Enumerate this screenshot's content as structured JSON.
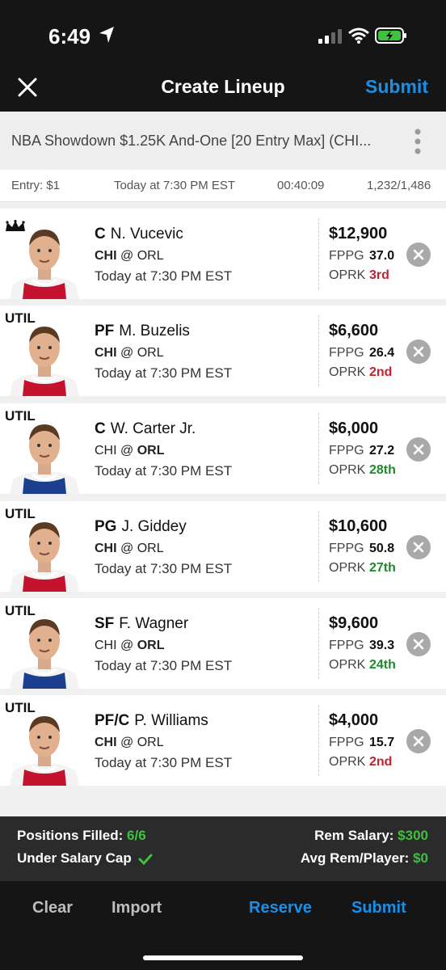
{
  "status_bar": {
    "time": "6:49"
  },
  "header": {
    "title": "Create Lineup",
    "submit_label": "Submit"
  },
  "contest": {
    "name": "NBA Showdown $1.25K And-One [20 Entry Max] (CHI...",
    "entry": "Entry: $1",
    "start": "Today at 7:30 PM EST",
    "countdown": "00:40:09",
    "entries": "1,232/1,486"
  },
  "players": [
    {
      "slot": "",
      "crown": true,
      "pos": "C",
      "name": "N. Vucevic",
      "team": "CHI",
      "at": "@",
      "opp": "ORL",
      "bold_side": "team",
      "time": "Today at 7:30 PM EST",
      "salary": "$12,900",
      "fppg_label": "FPPG",
      "fppg": "37.0",
      "oprk_label": "OPRK",
      "oprk": "3rd",
      "oprk_color": "red",
      "jersey": "red"
    },
    {
      "slot": "UTIL",
      "crown": false,
      "pos": "PF",
      "name": "M. Buzelis",
      "team": "CHI",
      "at": "@",
      "opp": "ORL",
      "bold_side": "team",
      "time": "Today at 7:30 PM EST",
      "salary": "$6,600",
      "fppg_label": "FPPG",
      "fppg": "26.4",
      "oprk_label": "OPRK",
      "oprk": "2nd",
      "oprk_color": "red",
      "jersey": "red"
    },
    {
      "slot": "UTIL",
      "crown": false,
      "pos": "C",
      "name": "W. Carter Jr.",
      "team": "CHI",
      "at": "@",
      "opp": "ORL",
      "bold_side": "opp",
      "time": "Today at 7:30 PM EST",
      "salary": "$6,000",
      "fppg_label": "FPPG",
      "fppg": "27.2",
      "oprk_label": "OPRK",
      "oprk": "28th",
      "oprk_color": "green",
      "jersey": "blue"
    },
    {
      "slot": "UTIL",
      "crown": false,
      "pos": "PG",
      "name": "J. Giddey",
      "team": "CHI",
      "at": "@",
      "opp": "ORL",
      "bold_side": "team",
      "time": "Today at 7:30 PM EST",
      "salary": "$10,600",
      "fppg_label": "FPPG",
      "fppg": "50.8",
      "oprk_label": "OPRK",
      "oprk": "27th",
      "oprk_color": "green",
      "jersey": "red"
    },
    {
      "slot": "UTIL",
      "crown": false,
      "pos": "SF",
      "name": "F. Wagner",
      "team": "CHI",
      "at": "@",
      "opp": "ORL",
      "bold_side": "opp",
      "time": "Today at 7:30 PM EST",
      "salary": "$9,600",
      "fppg_label": "FPPG",
      "fppg": "39.3",
      "oprk_label": "OPRK",
      "oprk": "24th",
      "oprk_color": "green",
      "jersey": "blue"
    },
    {
      "slot": "UTIL",
      "crown": false,
      "pos": "PF/C",
      "name": "P. Williams",
      "team": "CHI",
      "at": "@",
      "opp": "ORL",
      "bold_side": "team",
      "time": "Today at 7:30 PM EST",
      "salary": "$4,000",
      "fppg_label": "FPPG",
      "fppg": "15.7",
      "oprk_label": "OPRK",
      "oprk": "2nd",
      "oprk_color": "red",
      "jersey": "red"
    }
  ],
  "summary": {
    "positions_label": "Positions Filled:",
    "positions_value": "6/6",
    "cap_label": "Under Salary Cap",
    "rem_salary_label": "Rem Salary:",
    "rem_salary_value": "$300",
    "avg_rem_label": "Avg Rem/Player:",
    "avg_rem_value": "$0"
  },
  "bottom_bar": {
    "clear": "Clear",
    "import": "Import",
    "reserve": "Reserve",
    "submit": "Submit"
  },
  "colors": {
    "accent_blue": "#1a8fe8",
    "rank_red": "#c0232f",
    "rank_green": "#1e8a2d",
    "summary_green": "#3fc03f"
  },
  "icons": [
    "location-arrow-icon",
    "signal-icon",
    "wifi-icon",
    "battery-charging-icon",
    "close-icon",
    "more-vertical-icon",
    "crown-icon",
    "remove-icon",
    "checkmark-icon"
  ]
}
